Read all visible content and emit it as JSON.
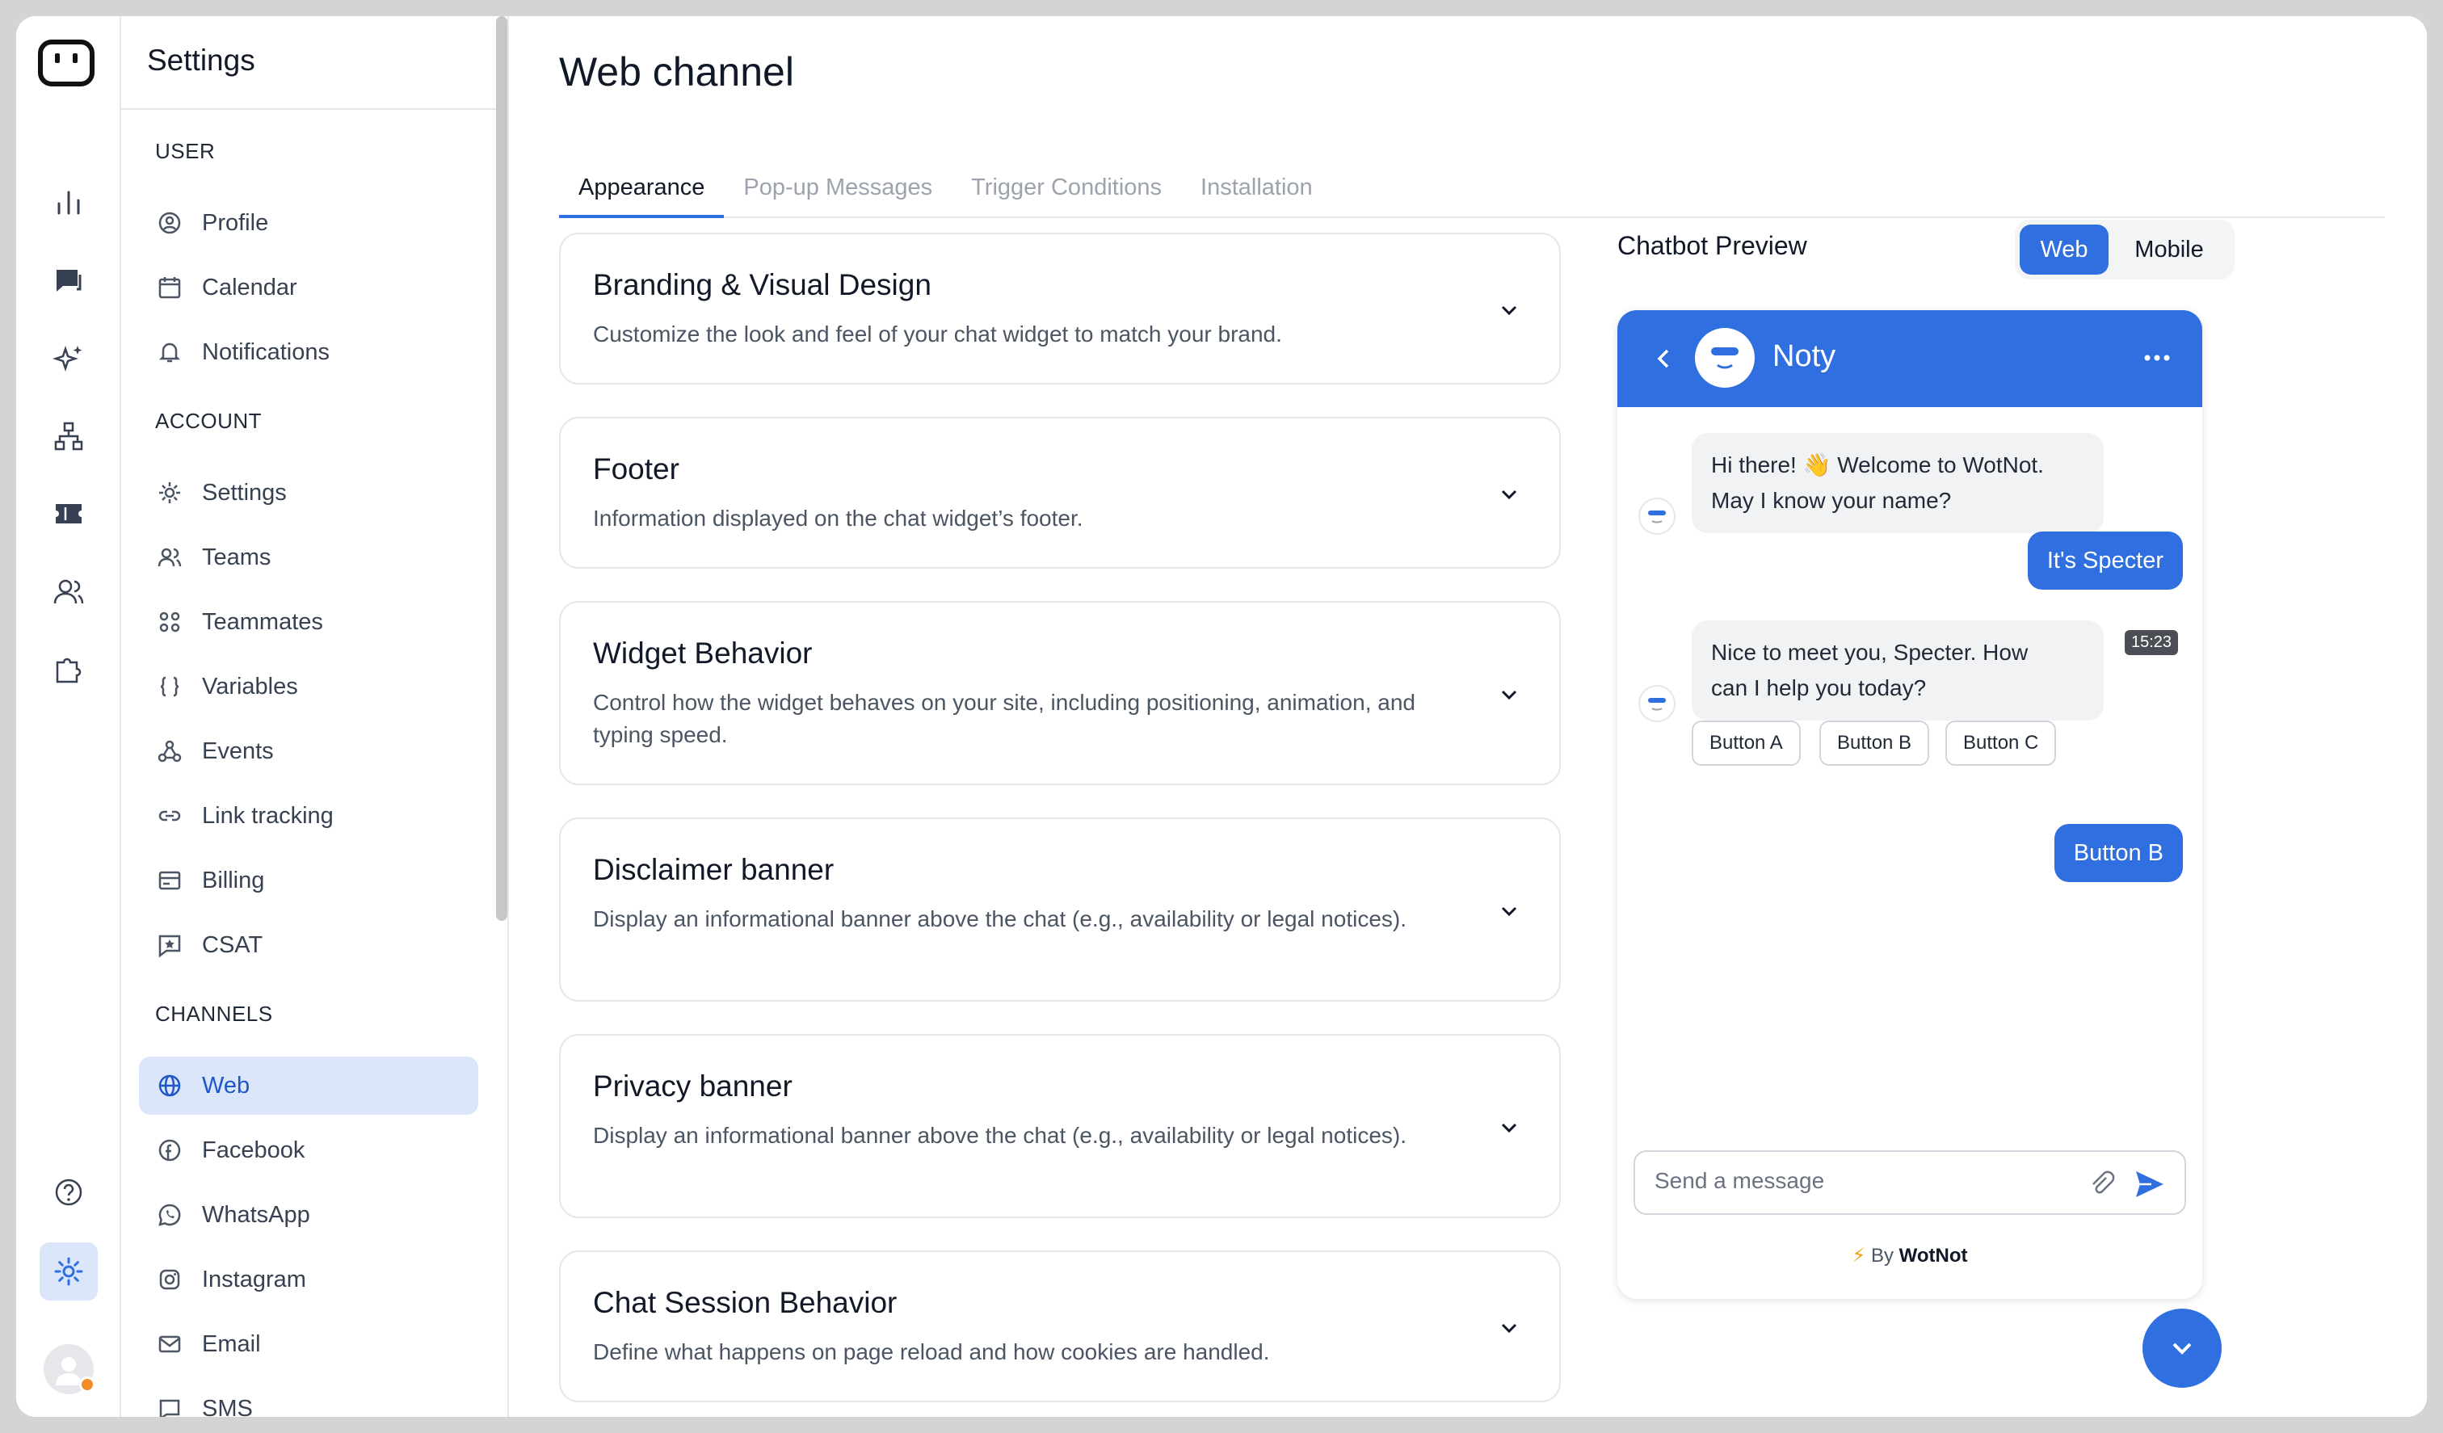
{
  "sidebar": {
    "title": "Settings",
    "user_label": "USER",
    "account_label": "ACCOUNT",
    "channels_label": "CHANNELS",
    "user_items": [
      "Profile",
      "Calendar",
      "Notifications"
    ],
    "account_items": [
      "Settings",
      "Teams",
      "Teammates",
      "Variables",
      "Events",
      "Link tracking",
      "Billing",
      "CSAT"
    ],
    "channel_items": [
      "Web",
      "Facebook",
      "WhatsApp",
      "Instagram",
      "Email",
      "SMS"
    ]
  },
  "page": {
    "title": "Web channel",
    "tabs": [
      "Appearance",
      "Pop-up Messages",
      "Trigger Conditions",
      "Installation"
    ]
  },
  "cards": [
    {
      "title": "Branding & Visual Design",
      "desc": "Customize the look and feel of your chat widget to match your brand."
    },
    {
      "title": "Footer",
      "desc": "Information displayed on the chat widget’s footer."
    },
    {
      "title": "Widget Behavior",
      "desc": "Control how the widget behaves on your site, including positioning, animation, and typing speed."
    },
    {
      "title": "Disclaimer banner",
      "desc": "Display an informational banner above the chat (e.g., availability or legal notices)."
    },
    {
      "title": "Privacy banner",
      "desc": "Display an informational banner above the chat (e.g., availability or legal notices)."
    },
    {
      "title": "Chat Session Behavior",
      "desc": "Define what happens on page reload and how cookies are handled."
    }
  ],
  "preview": {
    "label": "Chatbot Preview",
    "web": "Web",
    "mobile": "Mobile",
    "bot_name": "Noty",
    "msg1_line1": "Hi there! 👋 Welcome to WotNot.",
    "msg1_line2": "May I know your name?",
    "reply1": "It's Specter",
    "msg2_line1": "Nice to meet you, Specter. How",
    "msg2_line2": "can I help you today?",
    "time": "15:23",
    "quick_replies": [
      "Button A",
      "Button B",
      "Button C"
    ],
    "reply2": "Button B",
    "placeholder": "Send a message",
    "powered_by": "By",
    "brand": "WotNot"
  },
  "colors": {
    "accent": "#2f6fdf",
    "active_bg": "#dbe6fb",
    "status_dot": "#f28c28"
  }
}
